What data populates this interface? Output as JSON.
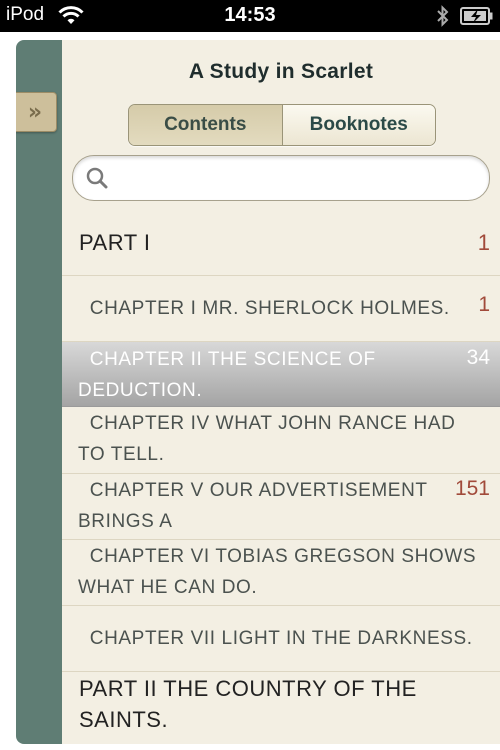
{
  "status_bar": {
    "carrier": "iPod",
    "time": "14:53"
  },
  "book": {
    "title": "A Study in Scarlet"
  },
  "segments": {
    "contents": "Contents",
    "booknotes": "Booknotes",
    "active": "Contents"
  },
  "search": {
    "value": "",
    "placeholder": ""
  },
  "toc": [
    {
      "title": "PART I",
      "page": "1",
      "type": "part"
    },
    {
      "title": "  CHAPTER I MR. SHERLOCK HOLMES.",
      "page": "1",
      "type": "chapter"
    },
    {
      "title": "  CHAPTER II THE SCIENCE OF DEDUCTION.",
      "page": "34",
      "type": "chapter",
      "selected": true
    },
    {
      "title": "  CHAPTER IV WHAT JOHN RANCE HAD TO TELL.",
      "page": "",
      "type": "chapter"
    },
    {
      "title": "  CHAPTER V OUR ADVERTISEMENT BRINGS A",
      "page": "151",
      "type": "chapter"
    },
    {
      "title": "  CHAPTER VI TOBIAS GREGSON SHOWS WHAT HE CAN DO.",
      "page": "",
      "type": "chapter"
    },
    {
      "title": "  CHAPTER VII LIGHT IN THE DARKNESS.",
      "page": "",
      "type": "chapter"
    },
    {
      "title": "PART II THE COUNTRY OF THE SAINTS.",
      "page": "",
      "type": "part"
    }
  ],
  "colors": {
    "rail": "#5f7d74",
    "paper": "#f3efe3",
    "page_number": "#a14a3a"
  },
  "icons": {
    "rail_handle": "double-chevron-right-icon",
    "search": "magnifier-icon"
  }
}
